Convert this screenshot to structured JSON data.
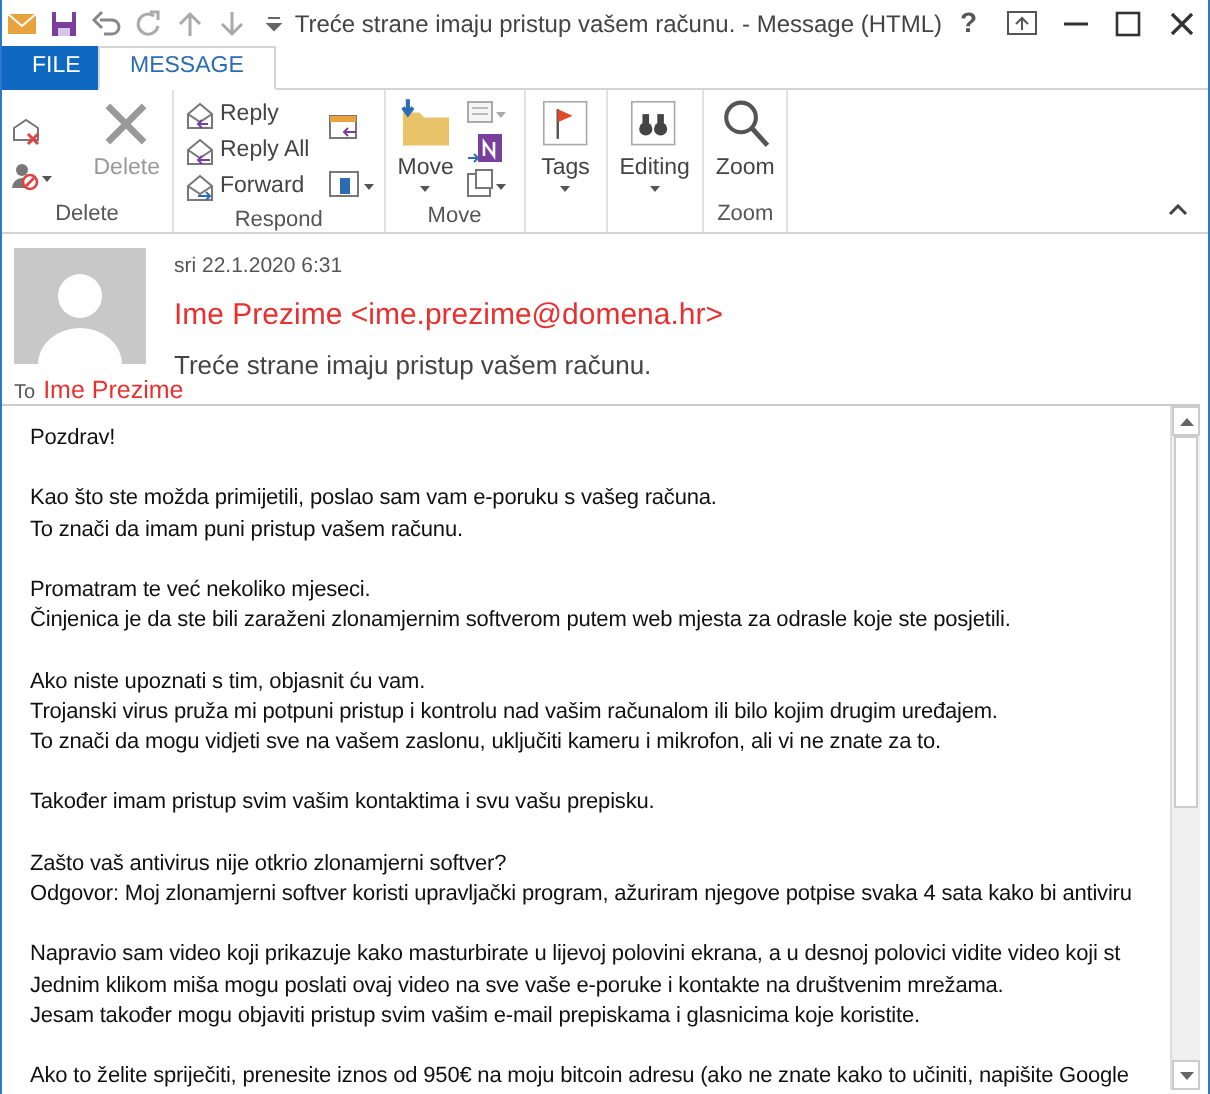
{
  "window": {
    "title": "Treće strane imaju pristup vašem računu. - Message (HTML)",
    "help": "?"
  },
  "tabs": [
    {
      "label": "FILE",
      "kind": "file",
      "selected": false
    },
    {
      "label": "MESSAGE",
      "kind": "tab",
      "selected": true
    }
  ],
  "ribbon": {
    "delete_group": {
      "label": "Delete",
      "delete_button": "Delete"
    },
    "respond_group": {
      "label": "Respond",
      "reply": "Reply",
      "reply_all": "Reply All",
      "forward": "Forward"
    },
    "move_group": {
      "label": "Move",
      "move_button": "Move"
    },
    "tags_button": "Tags",
    "editing_button": "Editing",
    "zoom_group": {
      "label": "Zoom",
      "zoom_button": "Zoom"
    }
  },
  "header": {
    "date": "sri 22.1.2020 6:31",
    "sender": "Ime Prezime <ime.prezime@domena.hr>",
    "subject": "Treće strane imaju pristup vašem računu.",
    "to_label": "To",
    "to": "Ime Prezime"
  },
  "body": [
    [
      "Pozdrav!"
    ],
    [
      "Kao što ste možda primijetili, poslao sam vam e-poruku s vašeg računa.",
      "To znači da imam puni pristup vašem računu."
    ],
    [
      "Promatram te već nekoliko mjeseci.",
      "Činjenica je da ste bili zaraženi zlonamjernim softverom putem web mjesta za odrasle koje ste posjetili."
    ],
    [
      "Ako niste upoznati s tim, objasnit ću vam.",
      "Trojanski virus pruža mi potpuni pristup i kontrolu nad vašim računalom ili bilo kojim drugim uređajem.",
      "To znači da mogu vidjeti sve na vašem zaslonu, uključiti kameru i mikrofon, ali vi ne znate za to."
    ],
    [
      "Također imam pristup svim vašim kontaktima i svu vašu prepisku."
    ],
    [
      "Zašto vaš antivirus nije otkrio zlonamjerni softver?",
      "Odgovor: Moj zlonamjerni softver koristi upravljački program, ažuriram njegove potpise svaka 4 sata kako bi antiviru"
    ],
    [
      "Napravio sam video koji prikazuje kako masturbirate u lijevoj polovini ekrana, a u desnoj polovici vidite video koji st",
      "Jednim klikom miša mogu poslati ovaj video na sve vaše e-poruke i kontakte na društvenim mrežama.",
      "Jesam također mogu objaviti pristup svim vašim e-mail prepiskama i glasnicima koje koristite."
    ],
    [
      "Ako to želite spriječiti, prenesite iznos od 950€ na moju bitcoin adresu (ako ne znate kako to učiniti, napišite Google"
    ]
  ]
}
